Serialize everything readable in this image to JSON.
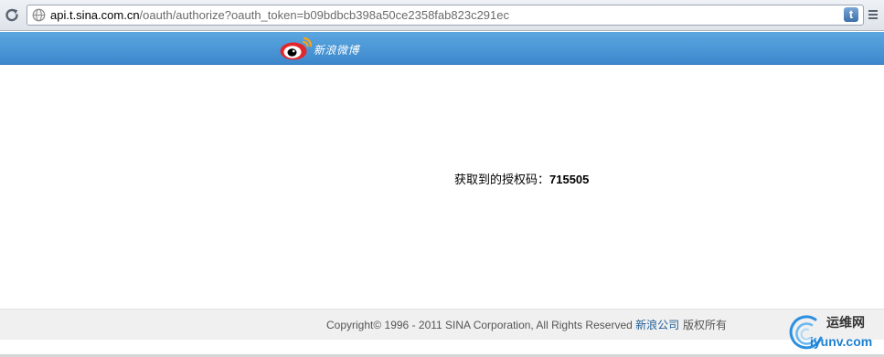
{
  "browser": {
    "url_host": "api.t.sina.com.cn",
    "url_path": "/oauth/authorize?oauth_token=b09bdbcb398a50ce2358fab823c291ec",
    "extension_letter": "t",
    "icons": [
      "reload-icon",
      "globe-icon",
      "twitter-extension-icon",
      "menu-icon"
    ]
  },
  "header": {
    "logo_text": "新浪微博",
    "logo_icon": "weibo-eye-logo",
    "background_color": "#4a96d8"
  },
  "main": {
    "auth_label": "获取到的授权码：",
    "auth_code": "715505"
  },
  "footer": {
    "copyright_text": "Copyright© 1996 - 2011 SINA Corporation, All Rights Reserved ",
    "company_link": "新浪公司",
    "rights_text": " 版权所有"
  },
  "watermark": {
    "cn_text": "运维网",
    "en_text": "iyunv.com"
  }
}
